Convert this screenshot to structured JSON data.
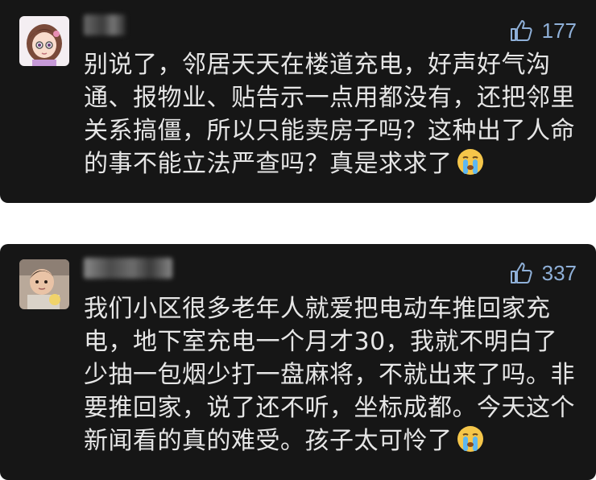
{
  "comments": [
    {
      "likes": "177",
      "text": "别说了，邻居天天在楼道充电，好声好气沟通、报物业、贴告示一点用都没有，还把邻里关系搞僵，所以只能卖房子吗？这种出了人命的事不能立法严查吗？真是求求了",
      "emoji": "crying-face-icon"
    },
    {
      "likes": "337",
      "text": "我们小区很多老年人就爱把电动车推回家充电，地下室充电一个月才30，我就不明白了少抽一包烟少打一盘麻将，不就出来了吗。非要推回家，说了还不听，坐标成都。今天这个新闻看的真的难受。孩子太可怜了",
      "emoji": "crying-face-icon"
    }
  ],
  "colors": {
    "card_bg": "#161616",
    "text": "#e6e6e6",
    "like": "#8fb0d8"
  }
}
